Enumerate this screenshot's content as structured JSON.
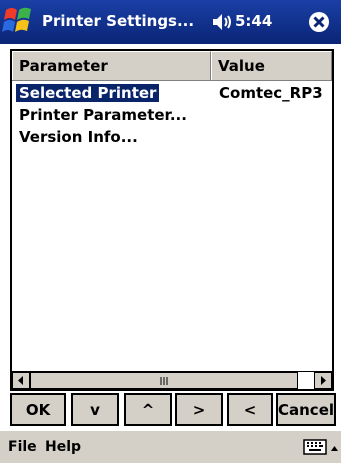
{
  "titlebar": {
    "title": "Printer Settings...",
    "time": "5:44",
    "start_icon": "windows-flag-icon",
    "volume_icon": "speaker-icon",
    "close_icon": "close-icon"
  },
  "table": {
    "columns": [
      "Parameter",
      "Value"
    ],
    "rows": [
      {
        "parameter": "Selected Printer",
        "value": "Comtec_RP3",
        "selected": true
      },
      {
        "parameter": "Printer Parameter...",
        "value": ""
      },
      {
        "parameter": "Version Info...",
        "value": ""
      }
    ]
  },
  "scrollbar": {
    "left_arrow": "◀",
    "right_arrow": "▶",
    "thumb_grip": "|||"
  },
  "buttons": {
    "ok": "OK",
    "down": "v",
    "up": "^",
    "right": ">",
    "left": "<",
    "cancel": "Cancel"
  },
  "menubar": {
    "file": "File",
    "help": "Help",
    "keyboard_icon": "keyboard-icon",
    "sip_arrow_icon": "up-arrow-icon"
  },
  "colors": {
    "titlebar": "#0a2576",
    "selection": "#0a246a",
    "face": "#d4d0c8"
  }
}
